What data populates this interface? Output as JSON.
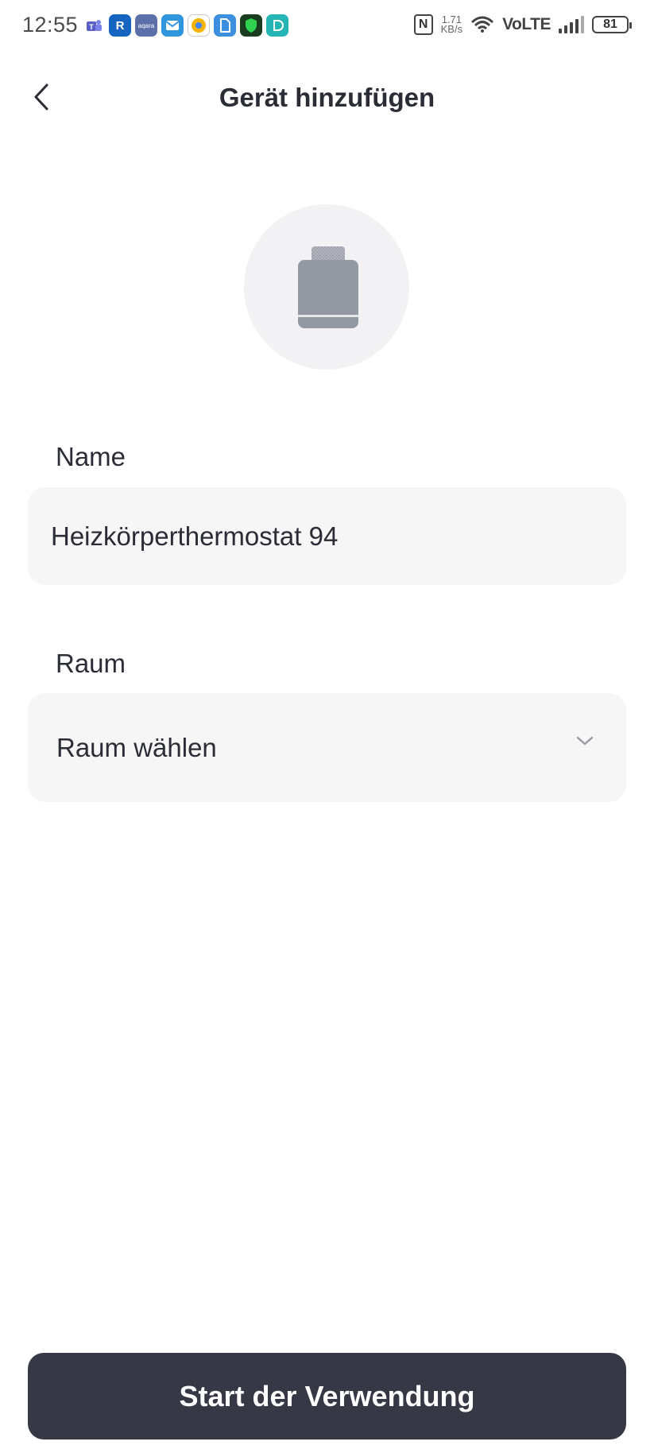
{
  "status_bar": {
    "time": "12:55",
    "net_speed_value": "1.71",
    "net_speed_unit": "KB/s",
    "network": "VoLTE",
    "battery": "81",
    "nfc_label": "N",
    "app_icons": [
      {
        "name": "teams-icon",
        "color": "#5a5fc7"
      },
      {
        "name": "r-app-icon",
        "color": "#1565c0"
      },
      {
        "name": "aqara-icon",
        "color": "#5b6fa8"
      },
      {
        "name": "mail-icon",
        "color": "#2f95dc"
      },
      {
        "name": "chrome-like-icon",
        "color": "#f5b400"
      },
      {
        "name": "sim-app-icon",
        "color": "#3d8fe0"
      },
      {
        "name": "security-icon",
        "color": "#1f9d3a"
      },
      {
        "name": "dash-app-icon",
        "color": "#26b5b5"
      }
    ]
  },
  "header": {
    "title": "Gerät hinzufügen",
    "back_icon": "chevron-left-icon"
  },
  "device": {
    "icon": "radiator-thermostat-icon"
  },
  "form": {
    "name_label": "Name",
    "name_value": "Heizkörperthermostat 94",
    "room_label": "Raum",
    "room_value": "Raum wählen"
  },
  "footer": {
    "start_label": "Start der Verwendung"
  }
}
